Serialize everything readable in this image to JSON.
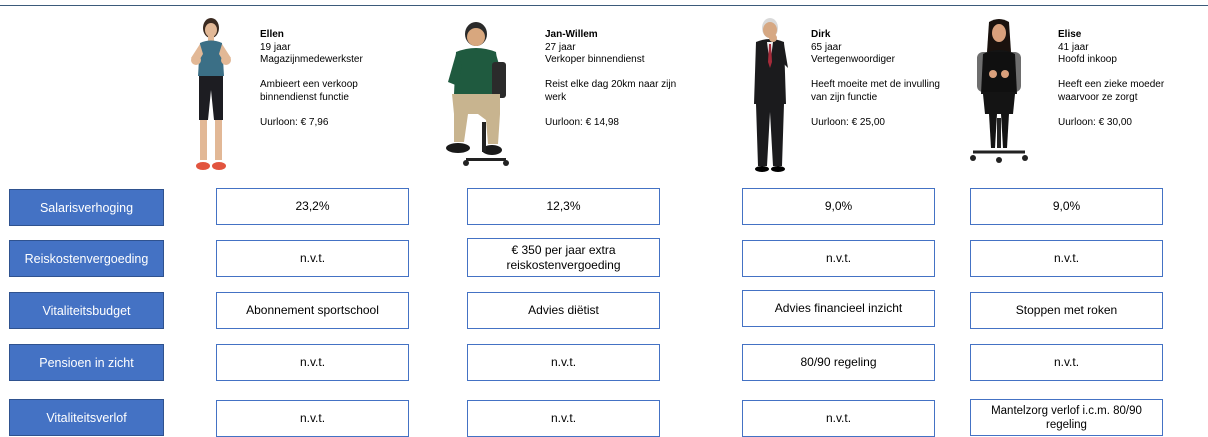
{
  "colors": {
    "accent": "#4472c4",
    "label_text": "#ffffff",
    "border": "#4472c4"
  },
  "people": [
    {
      "name": "Ellen",
      "age": "19 jaar",
      "role": "Magazijnmedewerkster",
      "note": "Ambieert een verkoop binnendienst functie",
      "wage": "Uurloon: € 7,96",
      "figure": "woman-thumbs-up-figure"
    },
    {
      "name": "Jan-Willem",
      "age": "27 jaar",
      "role": "Verkoper binnendienst",
      "note": "Reist elke dag 20km naar zijn werk",
      "wage": "Uurloon: € 14,98",
      "figure": "man-in-chair-figure"
    },
    {
      "name": "Dirk",
      "age": "65 jaar",
      "role": "Vertegenwoordiger",
      "note": "Heeft moeite met de invulling van zijn functie",
      "wage": "Uurloon: € 25,00",
      "figure": "man-in-suit-figure"
    },
    {
      "name": "Elise",
      "age": "41 jaar",
      "role": "Hoofd inkoop",
      "note": "Heeft een zieke moeder waarvoor ze zorgt",
      "wage": "Uurloon: € 30,00",
      "figure": "woman-in-chair-figure"
    }
  ],
  "rows": [
    {
      "label": "Salarisverhoging",
      "cells": [
        "23,2%",
        "12,3%",
        "9,0%",
        "9,0%"
      ]
    },
    {
      "label": "Reiskostenvergoeding",
      "cells": [
        "n.v.t.",
        "€ 350 per jaar extra reiskostenvergoeding",
        "n.v.t.",
        "n.v.t."
      ]
    },
    {
      "label": "Vitaliteitsbudget",
      "cells": [
        "Abonnement sportschool",
        "Advies diëtist",
        "Advies financieel inzicht",
        "Stoppen met roken"
      ]
    },
    {
      "label": "Pensioen in zicht",
      "cells": [
        "n.v.t.",
        "n.v.t.",
        "80/90 regeling",
        "n.v.t."
      ]
    },
    {
      "label": "Vitaliteitsverlof",
      "cells": [
        "n.v.t.",
        "n.v.t.",
        "n.v.t.",
        "Mantelzorg verlof i.c.m. 80/90 regeling"
      ]
    }
  ]
}
